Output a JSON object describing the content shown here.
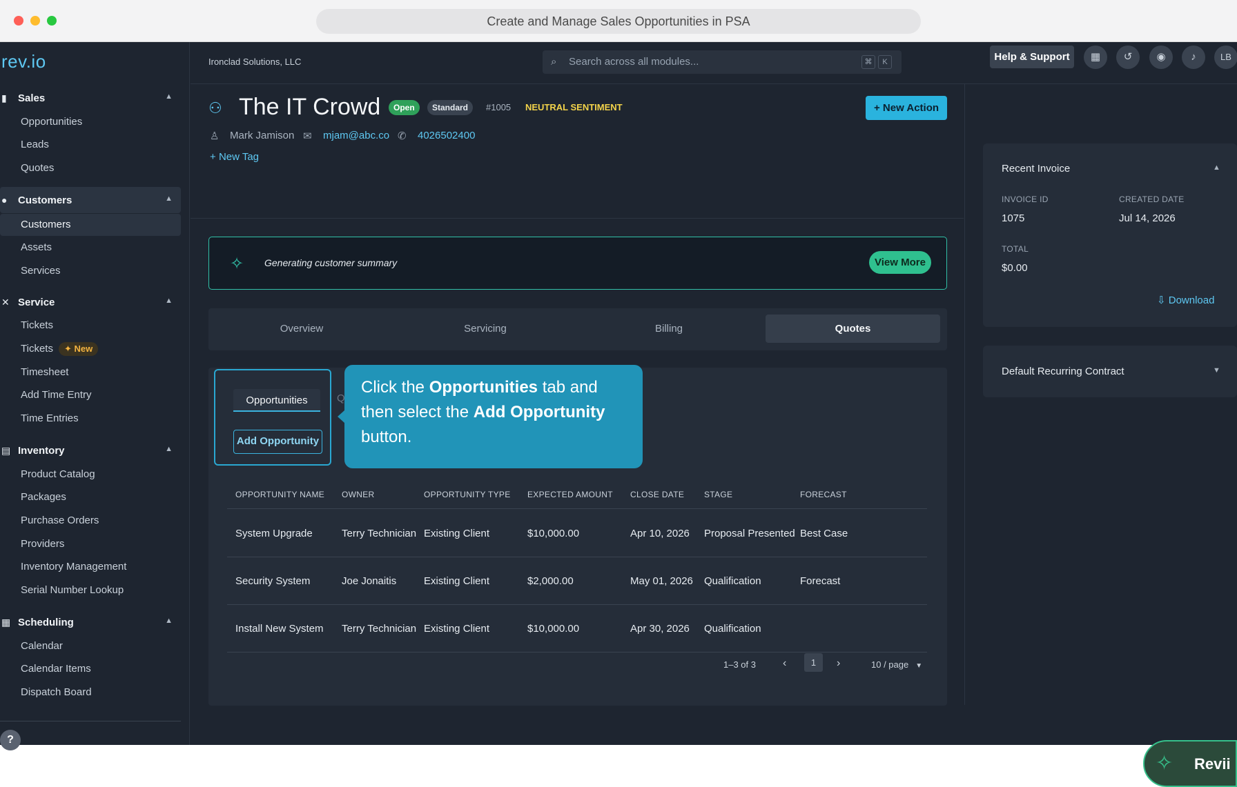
{
  "window": {
    "title": "Create and Manage Sales Opportunities in PSA"
  },
  "brand": {
    "logo": "rev.io"
  },
  "sidebar": {
    "sections": [
      {
        "label": "Sales",
        "icon": "bar-chart-icon",
        "items": [
          {
            "label": "Opportunities"
          },
          {
            "label": "Leads"
          },
          {
            "label": "Quotes"
          }
        ]
      },
      {
        "label": "Customers",
        "icon": "users-icon",
        "items": [
          {
            "label": "Customers"
          },
          {
            "label": "Assets"
          },
          {
            "label": "Services"
          }
        ]
      },
      {
        "label": "Service",
        "icon": "wrench-icon",
        "items": [
          {
            "label": "Tickets"
          },
          {
            "label": "Tickets",
            "badge": "New"
          },
          {
            "label": "Timesheet"
          },
          {
            "label": "Add Time Entry"
          },
          {
            "label": "Time Entries"
          }
        ]
      },
      {
        "label": "Inventory",
        "icon": "box-icon",
        "items": [
          {
            "label": "Product Catalog"
          },
          {
            "label": "Packages"
          },
          {
            "label": "Purchase Orders"
          },
          {
            "label": "Providers"
          },
          {
            "label": "Inventory Management"
          },
          {
            "label": "Serial Number Lookup"
          }
        ]
      },
      {
        "label": "Scheduling",
        "icon": "calendar-icon",
        "items": [
          {
            "label": "Calendar"
          },
          {
            "label": "Calendar Items"
          },
          {
            "label": "Dispatch Board"
          }
        ]
      }
    ],
    "help": "?"
  },
  "topbar": {
    "company": "Ironclad Solutions, LLC",
    "search_placeholder": "Search across all modules...",
    "kbd1": "⌘",
    "kbd2": "K",
    "help_label": "Help & Support",
    "avatar": "LB"
  },
  "customer": {
    "name": "The IT Crowd",
    "status": "Open",
    "tier": "Standard",
    "id": "#1005",
    "sentiment": "NEUTRAL SENTIMENT",
    "contact_name": "Mark Jamison",
    "email": "mjam@abc.co",
    "phone": "4026502400",
    "new_tag": "New Tag",
    "new_action": "New Action"
  },
  "summary": {
    "text": "Generating customer summary",
    "button": "View More"
  },
  "tabs": [
    "Overview",
    "Servicing",
    "Billing",
    "Quotes"
  ],
  "active_tab": "Quotes",
  "subtabs": {
    "active": "Opportunities",
    "partial": "Q",
    "add_button": "Add Opportunity"
  },
  "tooltip": {
    "t1": "Click the ",
    "b1": "Opportunities",
    "t2": " tab and then select the ",
    "b2": "Add Opportunity",
    "t3": " button."
  },
  "table": {
    "columns": [
      "OPPORTUNITY NAME",
      "OWNER",
      "OPPORTUNITY TYPE",
      "EXPECTED AMOUNT",
      "CLOSE DATE",
      "STAGE",
      "FORECAST"
    ],
    "rows": [
      [
        "System Upgrade",
        "Terry Technician",
        "Existing Client",
        "$10,000.00",
        "Apr 10, 2026",
        "Proposal Presented",
        "Best Case"
      ],
      [
        "Security System",
        "Joe Jonaitis",
        "Existing Client",
        "$2,000.00",
        "May 01, 2026",
        "Qualification",
        "Forecast"
      ],
      [
        "Install New System",
        "Terry Technician",
        "Existing Client",
        "$10,000.00",
        "Apr 30, 2026",
        "Qualification",
        ""
      ]
    ]
  },
  "pagination": {
    "range": "1–3 of 3",
    "page": "1",
    "per_page": "10 / page"
  },
  "recent_invoice": {
    "title": "Recent Invoice",
    "invoice_id_label": "INVOICE ID",
    "invoice_id": "1075",
    "created_label": "CREATED DATE",
    "created": "Jul 14, 2026",
    "total_label": "TOTAL",
    "total": "$0.00",
    "download": "Download"
  },
  "default_contract": {
    "title": "Default Recurring Contract"
  },
  "assistant": {
    "label": "Revii"
  },
  "colors": {
    "accent": "#2ab3de",
    "success": "#2fc08f",
    "sentiment": "#f3d34a",
    "background": "#1e2530"
  }
}
